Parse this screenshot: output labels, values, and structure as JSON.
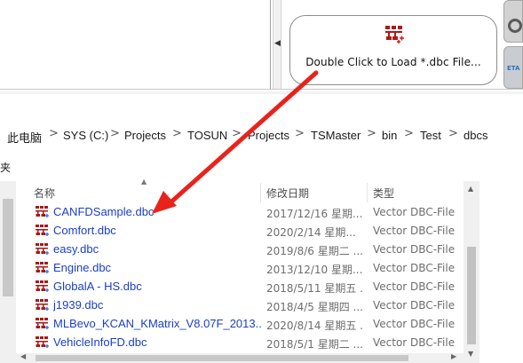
{
  "dbc_panel": {
    "prompt": "Double Click to Load *.dbc File...",
    "icon": "dbc-network-icon"
  },
  "side_widget": {
    "label": "ETA"
  },
  "address_bar": {
    "crumbs": [
      "此电脑",
      "SYS (C:)",
      "Projects",
      "TOSUN",
      "Projects",
      "TSMaster",
      "bin",
      "Test",
      "dbcs"
    ],
    "separator": ">"
  },
  "nav_fragment": "夹",
  "columns": {
    "name": "名称",
    "date": "修改日期",
    "type": "类型"
  },
  "files": [
    {
      "name": "CANFDSample.dbc",
      "date": "2017/12/16 星期...",
      "type": "Vector DBC-File"
    },
    {
      "name": "Comfort.dbc",
      "date": "2020/2/14 星期...",
      "type": "Vector DBC-File"
    },
    {
      "name": "easy.dbc",
      "date": "2019/8/6 星期二 ...",
      "type": "Vector DBC-File"
    },
    {
      "name": "Engine.dbc",
      "date": "2013/12/10 星期...",
      "type": "Vector DBC-File"
    },
    {
      "name": "GlobalA - HS.dbc",
      "date": "2018/5/11 星期五 ...",
      "type": "Vector DBC-File"
    },
    {
      "name": "j1939.dbc",
      "date": "2018/4/5 星期四 ...",
      "type": "Vector DBC-File"
    },
    {
      "name": "MLBevo_KCAN_KMatrix_V8.07F_2013...",
      "date": "2020/8/14 星期五 ...",
      "type": "Vector DBC-File"
    },
    {
      "name": "VehicleInfoFD.dbc",
      "date": "2018/5/1 星期二 ...",
      "type": "Vector DBC-File"
    }
  ],
  "colors": {
    "link_blue": "#1a3fc4",
    "annotation_red": "#e8231c"
  }
}
